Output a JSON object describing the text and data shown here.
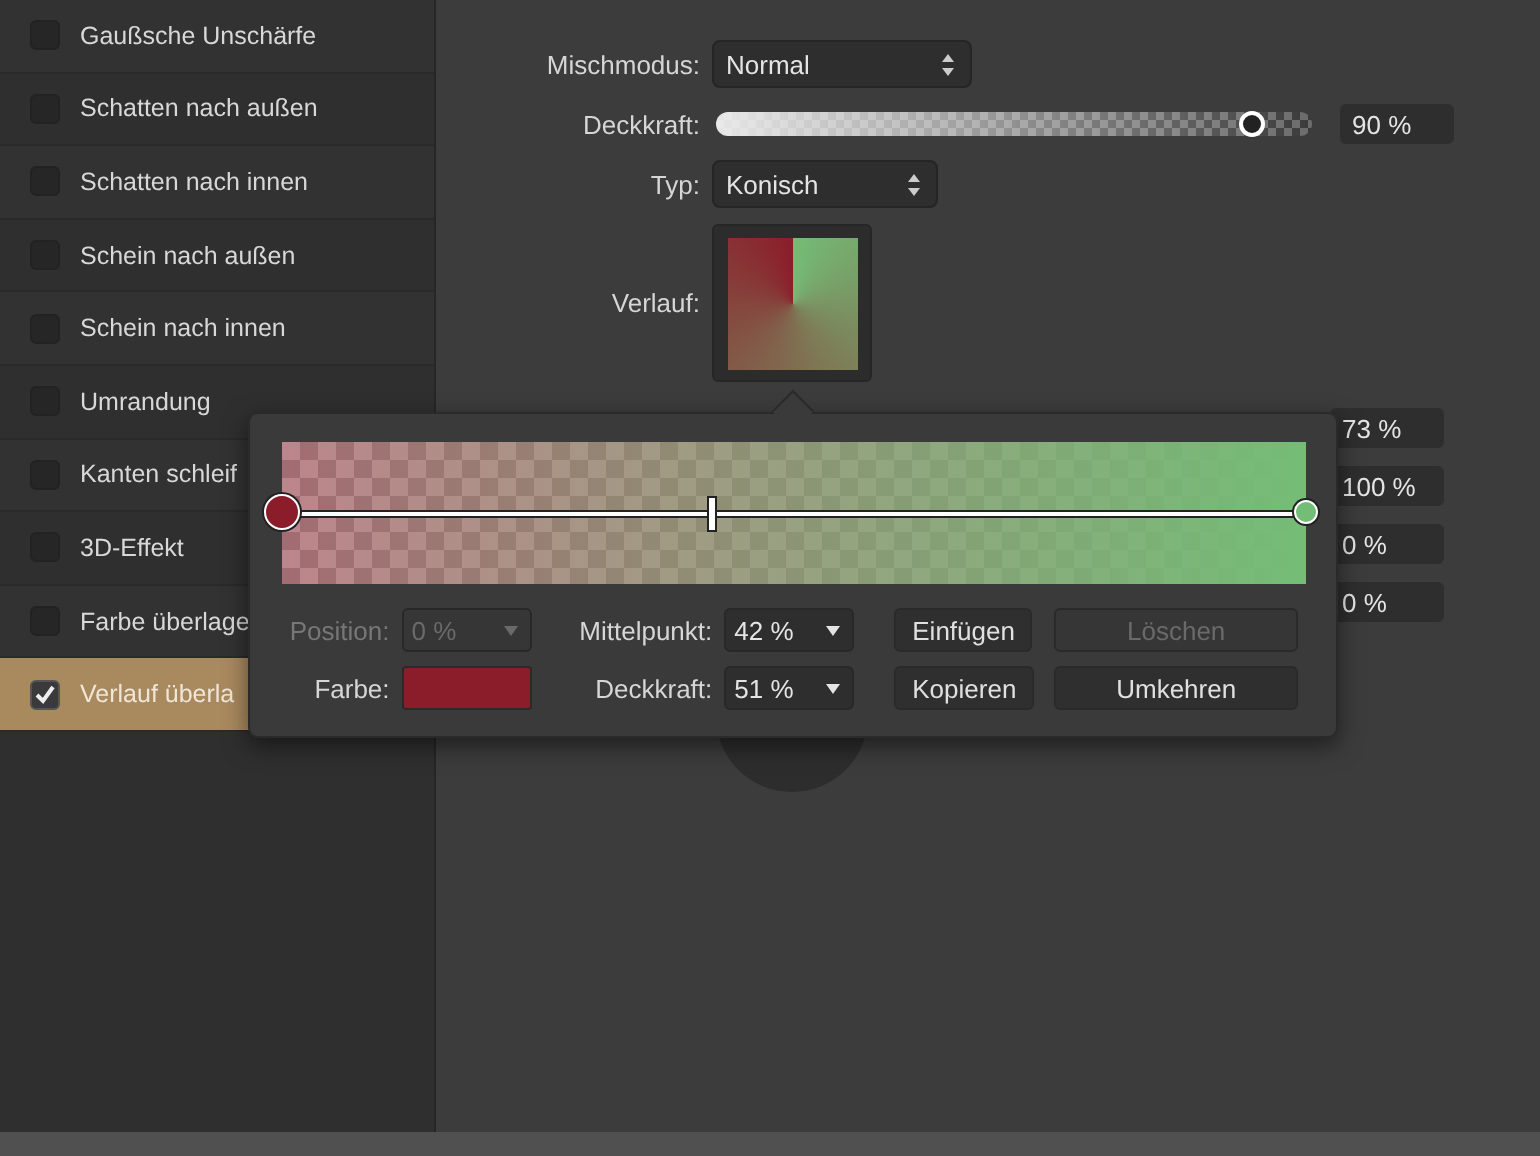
{
  "sidebar": {
    "items": [
      {
        "label": "Gaußsche Unschärfe",
        "checked": false,
        "selected": false
      },
      {
        "label": "Schatten nach außen",
        "checked": false,
        "selected": false
      },
      {
        "label": "Schatten nach innen",
        "checked": false,
        "selected": false
      },
      {
        "label": "Schein nach außen",
        "checked": false,
        "selected": false
      },
      {
        "label": "Schein nach innen",
        "checked": false,
        "selected": false
      },
      {
        "label": "Umrandung",
        "checked": false,
        "selected": false
      },
      {
        "label": "Kanten schleif",
        "checked": false,
        "selected": false
      },
      {
        "label": "3D-Effekt",
        "checked": false,
        "selected": false
      },
      {
        "label": "Farbe überlage",
        "checked": false,
        "selected": false
      },
      {
        "label": "Verlauf überla",
        "checked": true,
        "selected": true
      }
    ]
  },
  "settings": {
    "blend_mode": {
      "label": "Mischmodus:",
      "value": "Normal"
    },
    "opacity": {
      "label": "Deckkraft:",
      "level": 0.9,
      "value": "90 %"
    },
    "type": {
      "label": "Typ:",
      "value": "Konisch"
    },
    "gradient": {
      "label": "Verlauf:"
    },
    "fields": [
      "73 %",
      "100 %",
      "0 %",
      "0 %"
    ]
  },
  "gradient_editor": {
    "stops": [
      {
        "color": "#8b1d2a",
        "level": 0,
        "selected": true
      },
      {
        "color": "#74bd76",
        "level": 1,
        "selected": false
      }
    ],
    "midpoint_handle": {
      "level": 0.42
    },
    "position": {
      "label": "Position:",
      "value": "0 %",
      "disabled": true
    },
    "midpoint": {
      "label": "Mittelpunkt:",
      "value": "42 %"
    },
    "color": {
      "label": "Farbe:",
      "color": "#8b1d2a"
    },
    "opacity": {
      "label": "Deckkraft:",
      "value": "51 %"
    },
    "buttons": [
      {
        "label": "Einfügen",
        "disabled": false
      },
      {
        "label": "Löschen",
        "disabled": true
      },
      {
        "label": "Kopieren",
        "disabled": false
      },
      {
        "label": "Umkehren",
        "disabled": false
      }
    ]
  }
}
